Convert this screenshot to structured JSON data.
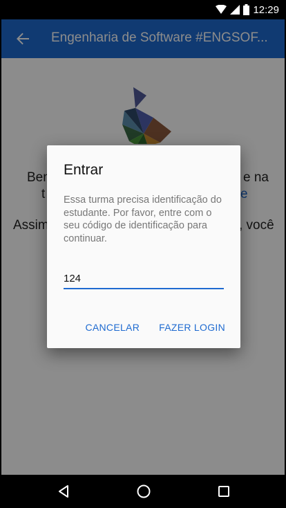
{
  "status_bar": {
    "time": "12:29",
    "icons": [
      "wifi-icon",
      "signal-icon",
      "battery-icon"
    ]
  },
  "app_bar": {
    "title": "Engenharia de Software #ENGSOF...",
    "back_icon": "arrow-back-icon"
  },
  "content": {
    "line1_left": "Ben",
    "line1_right": "e na",
    "line2_left": "t",
    "line2_right": "e",
    "line3_left": "Assim",
    "line3_right": ", você"
  },
  "dialog": {
    "title": "Entrar",
    "message": "Essa turma precisa identificação do estudante. Por favor, entre com o seu código de identificação para continuar.",
    "input_value": "124",
    "cancel_label": "CANCELAR",
    "login_label": "FAZER LOGIN"
  },
  "nav_bar": {
    "icons": [
      "back-triangle-icon",
      "home-circle-icon",
      "recents-square-icon"
    ]
  },
  "colors": {
    "primary": "#1e6ad0",
    "status_bar": "#000000",
    "dialog_bg": "#fafafa"
  }
}
